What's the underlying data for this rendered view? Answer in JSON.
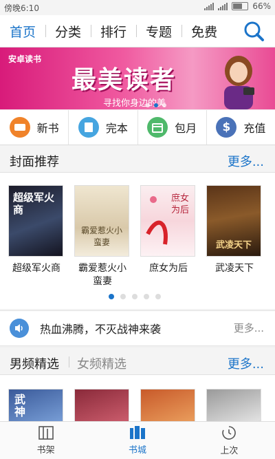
{
  "status": {
    "time": "傍晚6:10",
    "battery": "66%"
  },
  "nav": {
    "tabs": [
      "首页",
      "分类",
      "排行",
      "专题",
      "免费"
    ],
    "active": 0
  },
  "banner": {
    "brand": "安卓读书",
    "headline": "最美读者",
    "sub": "寻找你身边的美"
  },
  "quick": [
    {
      "label": "新书",
      "color": "#f0832a"
    },
    {
      "label": "完本",
      "color": "#46a5e0"
    },
    {
      "label": "包月",
      "color": "#4fb96b"
    },
    {
      "label": "充值",
      "color": "#4a72b8"
    }
  ],
  "featured": {
    "title": "封面推荐",
    "more": "更多...",
    "books": [
      {
        "title": "超级军火商",
        "cover_text": "超级军火商"
      },
      {
        "title": "霸爱惹火小蛮妻",
        "cover_text": "霸爱惹火小蛮妻"
      },
      {
        "title": "庶女为后",
        "cover_text": "庶女为后"
      },
      {
        "title": "武凌天下",
        "cover_text": "武凌天下"
      }
    ]
  },
  "notice": {
    "text": "热血沸腾，不灭战神来袭",
    "more": "更多..."
  },
  "genre": {
    "male": "男频精选",
    "female": "女频精选",
    "more": "更多..."
  },
  "genre_books": [
    {
      "cover_text": "武神"
    },
    {
      "cover_text": ""
    },
    {
      "cover_text": ""
    },
    {
      "cover_text": ""
    }
  ],
  "bottom": [
    {
      "label": "书架",
      "icon": "bookshelf-icon"
    },
    {
      "label": "书城",
      "icon": "bookstore-icon"
    },
    {
      "label": "上次",
      "icon": "history-icon"
    }
  ]
}
